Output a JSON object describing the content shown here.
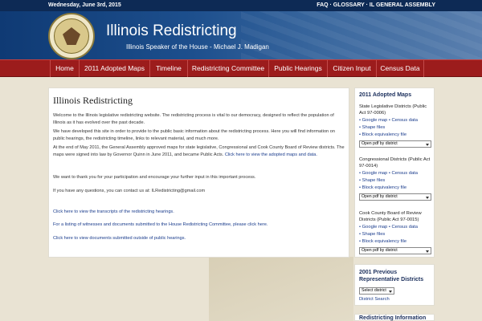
{
  "topbar": {
    "date": "Wednesday, June 3rd, 2015",
    "links": "FAQ · GLOSSARY · IL GENERAL ASSEMBLY"
  },
  "header": {
    "title": "Illinois Redistricting",
    "subtitle": "Illinois Speaker of the House - Michael J. Madigan"
  },
  "nav": [
    {
      "label": "Home"
    },
    {
      "label": "2011 Adopted Maps"
    },
    {
      "label": "Timeline"
    },
    {
      "label": "Redistricting Committee"
    },
    {
      "label": "Public Hearings"
    },
    {
      "label": "Citizen Input"
    },
    {
      "label": "Census Data"
    }
  ],
  "main": {
    "heading": "Illinois Redistricting",
    "p1": "Welcome to the Illinois legislative redistricting website. The redistricting process is vital to our democracy, designed to reflect the population of Illinois as it has evolved over the past decade.",
    "p2": "We have developed this site in order to provide to the public basic information about the redistricting process. Here you will find information on public hearings, the redistricting timeline, links to relevant material, and much more.",
    "p3": "At the end of May 2011, the General Assembly approved maps for state legislative, Congressional and Cook County Board of Review districts. The maps were signed into law by Governor Quinn in June 2011, and became Public Acts.",
    "p3_link": "Click here to view the adopted maps and data.",
    "p4": "We want to thank you for your participation and encourage your further input in this important process.",
    "p5": "If you have any questions, you can contact us at: ILRedistricting@gmail.com",
    "link1": "Click here to view the transcripts of the redistricting hearings.",
    "link2": "For a listing of witnesses and documents submitted to the House Redistricting Committee, please click here.",
    "link3": "Click here to view documents submitted outside of public hearings."
  },
  "sidebar": {
    "heading": "2011 Adopted Maps",
    "groups": [
      {
        "title": "State Legislative Districts (Public Act 97-0006)",
        "links": "• Google map • Census data",
        "shape": "• Shape files",
        "block": "• Block equivalency file",
        "select": "Open pdf by district"
      },
      {
        "title": "Congressional Districts (Public Act 97-0014)",
        "links": "• Google map • Census data",
        "shape": "• Shape files",
        "block": "• Block equivalency file",
        "select": "Open pdf by district"
      },
      {
        "title": "Cook County Board of Review Districts (Public Act 97-0015)",
        "links": "• Google map • Census data",
        "shape": "• Shape files",
        "block": "• Block equivalency file",
        "select": "Open pdf by district"
      }
    ]
  },
  "sidebar2": {
    "heading": "2001 Previous Representative Districts",
    "select": "Select district",
    "search": "District Search"
  },
  "sidebar3": {
    "heading": "Redistricting Information"
  }
}
